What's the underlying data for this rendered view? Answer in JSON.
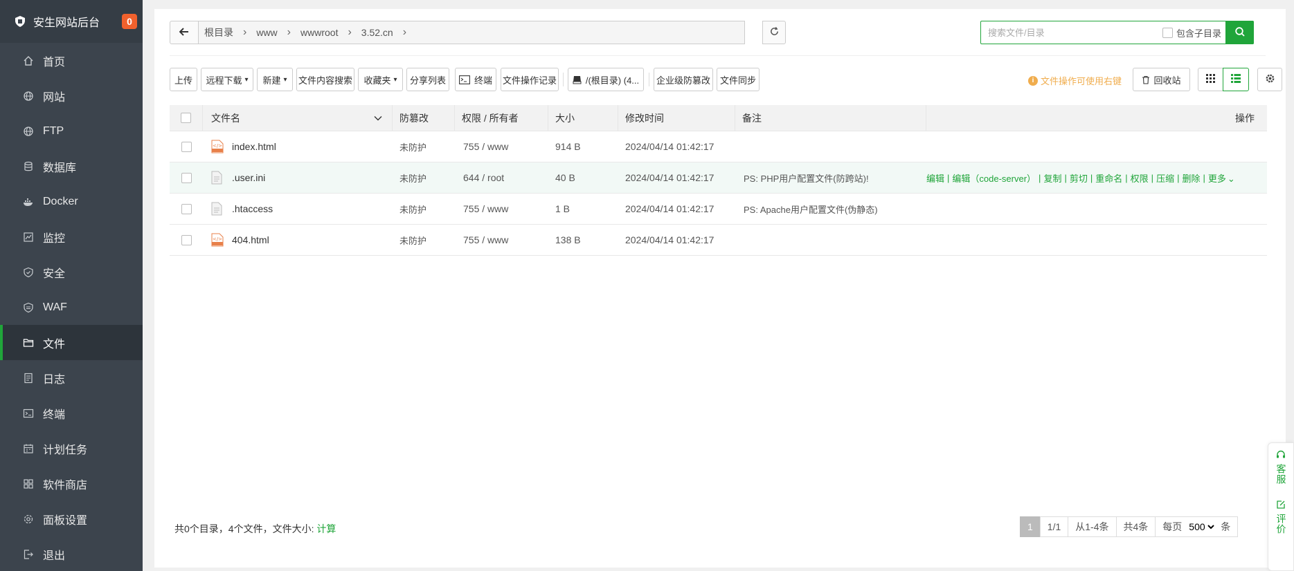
{
  "sidebar": {
    "brand_title": "安生网站后台",
    "badge": "0",
    "items": [
      {
        "label": "首页",
        "icon": "home-icon"
      },
      {
        "label": "网站",
        "icon": "globe-icon"
      },
      {
        "label": "FTP",
        "icon": "ftp-globe-icon"
      },
      {
        "label": "数据库",
        "icon": "database-icon"
      },
      {
        "label": "Docker",
        "icon": "docker-icon"
      },
      {
        "label": "监控",
        "icon": "monitor-icon"
      },
      {
        "label": "安全",
        "icon": "shield-icon"
      },
      {
        "label": "WAF",
        "icon": "waf-shield-icon"
      },
      {
        "label": "文件",
        "icon": "folder-icon",
        "active": true
      },
      {
        "label": "日志",
        "icon": "log-icon"
      },
      {
        "label": "终端",
        "icon": "terminal-icon"
      },
      {
        "label": "计划任务",
        "icon": "calendar-icon"
      },
      {
        "label": "软件商店",
        "icon": "apps-icon"
      },
      {
        "label": "面板设置",
        "icon": "settings-icon"
      },
      {
        "label": "退出",
        "icon": "logout-icon"
      }
    ]
  },
  "breadcrumb": [
    "根目录",
    "www",
    "wwwroot",
    "3.52.cn"
  ],
  "search": {
    "placeholder": "搜索文件/目录",
    "include_subdir": "包含子目录"
  },
  "toolbar": {
    "upload": "上传",
    "remote_download": "远程下载",
    "new": "新建",
    "content_search": "文件内容搜索",
    "favorites": "收藏夹",
    "share_list": "分享列表",
    "terminal": "终端",
    "op_log": "文件操作记录",
    "disk": "/(根目录) (4...",
    "tamper": "企业级防篡改",
    "sync": "文件同步",
    "tip": "文件操作可使用右键",
    "recycle": "回收站"
  },
  "table": {
    "headers": {
      "name": "文件名",
      "protect": "防篡改",
      "perm": "权限 / 所有者",
      "size": "大小",
      "mtime": "修改时间",
      "note": "备注",
      "ops": "操作"
    },
    "rows": [
      {
        "name": "index.html",
        "type": "html",
        "protect": "未防护",
        "perm": "755 / www",
        "size": "914 B",
        "mtime": "2024/04/14 01:42:17",
        "note": ""
      },
      {
        "name": ".user.ini",
        "type": "text",
        "protect": "未防护",
        "perm": "644 / root",
        "size": "40 B",
        "mtime": "2024/04/14 01:42:17",
        "note": "PS: PHP用户配置文件(防跨站)!"
      },
      {
        "name": ".htaccess",
        "type": "text",
        "protect": "未防护",
        "perm": "755 / www",
        "size": "1 B",
        "mtime": "2024/04/14 01:42:17",
        "note": "PS: Apache用户配置文件(伪静态)"
      },
      {
        "name": "404.html",
        "type": "html",
        "protect": "未防护",
        "perm": "755 / www",
        "size": "138 B",
        "mtime": "2024/04/14 01:42:17",
        "note": ""
      }
    ],
    "ops": [
      "编辑",
      "编辑（code-server）",
      "复制",
      "剪切",
      "重命名",
      "权限",
      "压缩",
      "删除",
      "更多"
    ]
  },
  "footer": {
    "summary": "共0个目录，4个文件，文件大小:",
    "calc": "计算"
  },
  "pager": {
    "current": "1",
    "pages": "1/1",
    "range": "从1-4条",
    "total": "共4条",
    "per_page_label": "每页",
    "per_page": "500",
    "unit": "条"
  },
  "float": {
    "service": "客服",
    "review": "评价"
  },
  "colors": {
    "accent": "#20a53a",
    "sidebar_bg": "#3c444d",
    "badge": "#f1612d",
    "tip": "#f0ad4e"
  }
}
